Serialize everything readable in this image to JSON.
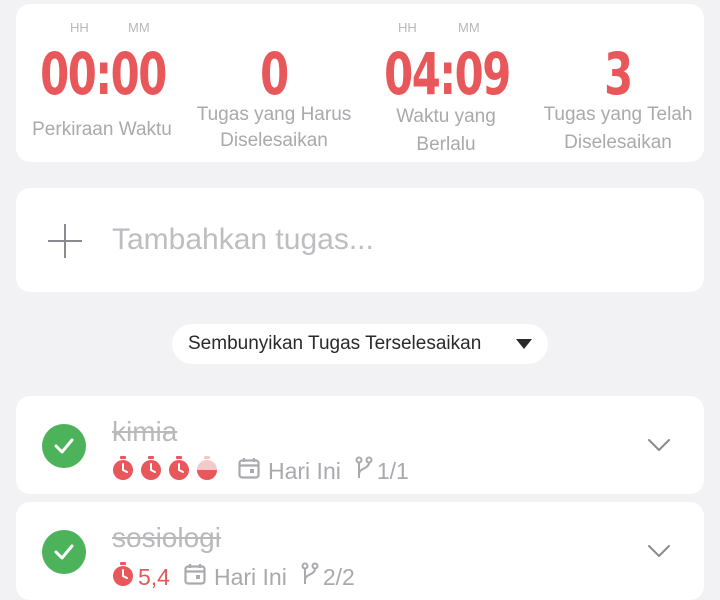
{
  "stats": [
    {
      "units": [
        "HH",
        "MM"
      ],
      "value": "00:00",
      "label": [
        "Perkiraan Waktu",
        ""
      ]
    },
    {
      "units": [],
      "value": "0",
      "label": [
        "Tugas yang Harus",
        "Diselesaikan"
      ]
    },
    {
      "units": [
        "HH",
        "MM"
      ],
      "value": "04:09",
      "label": [
        "Waktu yang",
        "Berlalu"
      ]
    },
    {
      "units": [],
      "value": "3",
      "label": [
        "Tugas yang Telah",
        "Diselesaikan"
      ]
    }
  ],
  "add_task": {
    "placeholder": "Tambahkan tugas..."
  },
  "toggle": {
    "label": "Sembunyikan Tugas Terselesaikan"
  },
  "tasks": [
    {
      "title": "kimia",
      "pomodoros": {
        "done": 3,
        "total": 4
      },
      "due": "Hari Ini",
      "subtasks": "1/1"
    },
    {
      "title": "sosiologi",
      "pomodoro_count": "5,4",
      "due": "Hari Ini",
      "subtasks": "2/2"
    }
  ],
  "colors": {
    "accent": "#e8575a",
    "check": "#4cb35a",
    "muted": "#a9a9ae"
  },
  "icons": [
    "plus-icon",
    "caret-down-icon",
    "check-icon",
    "timer-icon",
    "calendar-icon",
    "subtask-icon",
    "chevron-down-icon"
  ]
}
